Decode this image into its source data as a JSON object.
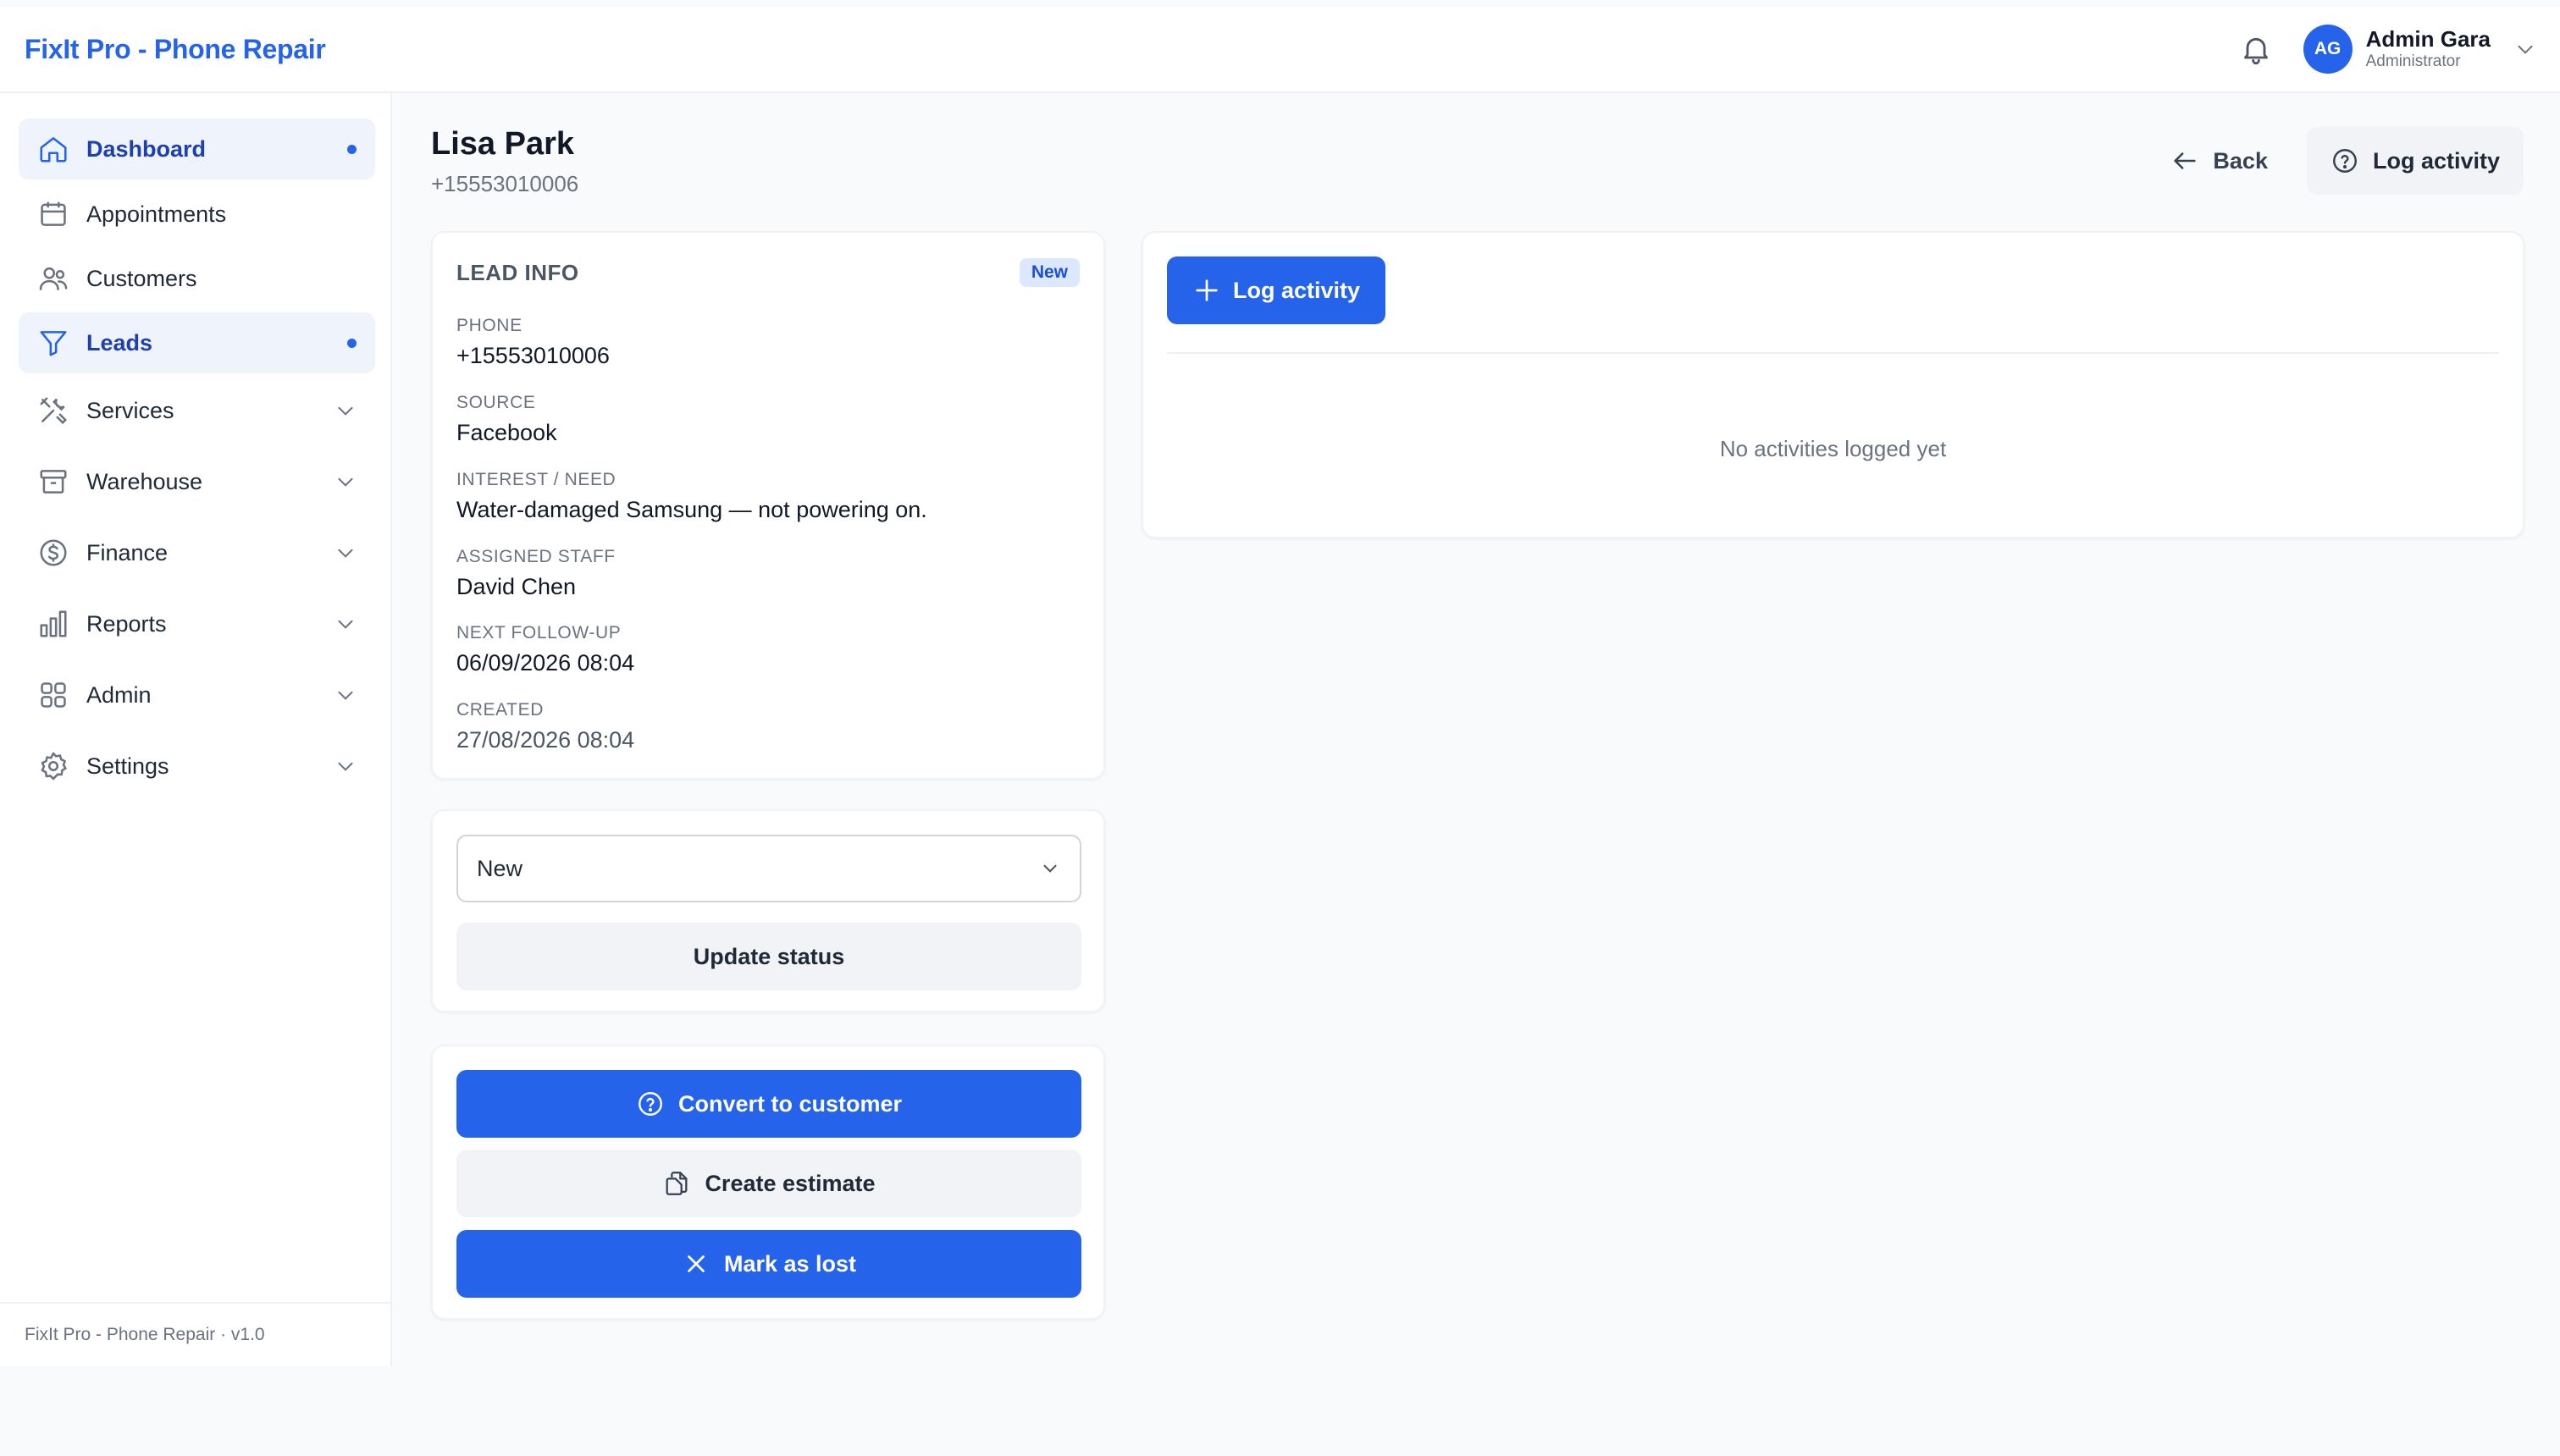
{
  "app": {
    "brand": "FixIt Pro - Phone Repair",
    "footer": "FixIt Pro - Phone Repair · v1.0"
  },
  "user": {
    "initials": "AG",
    "name": "Admin Gara",
    "role": "Administrator"
  },
  "sidebar": {
    "items": [
      {
        "label": "Dashboard",
        "icon": "home-icon",
        "active": true
      },
      {
        "label": "Appointments",
        "icon": "calendar-icon"
      },
      {
        "label": "Customers",
        "icon": "users-icon"
      },
      {
        "label": "Leads",
        "icon": "funnel-icon",
        "active": true
      },
      {
        "label": "Services",
        "icon": "tools-icon",
        "expandable": true
      },
      {
        "label": "Warehouse",
        "icon": "archive-icon",
        "expandable": true
      },
      {
        "label": "Finance",
        "icon": "dollar-icon",
        "expandable": true
      },
      {
        "label": "Reports",
        "icon": "bar-chart-icon",
        "expandable": true
      },
      {
        "label": "Admin",
        "icon": "grid-icon",
        "expandable": true
      },
      {
        "label": "Settings",
        "icon": "gear-icon",
        "expandable": true
      }
    ]
  },
  "lead": {
    "name": "Lisa Park",
    "phone_sub": "+15553010006"
  },
  "header_actions": {
    "back": "Back",
    "log_activity": "Log activity"
  },
  "lead_info": {
    "title": "LEAD INFO",
    "badge": "New",
    "fields": [
      {
        "label": "PHONE",
        "value": "+15553010006"
      },
      {
        "label": "SOURCE",
        "value": "Facebook"
      },
      {
        "label": "INTEREST / NEED",
        "value": "Water-damaged Samsung — not powering on."
      },
      {
        "label": "ASSIGNED STAFF",
        "value": "David Chen"
      },
      {
        "label": "NEXT FOLLOW-UP",
        "value": "06/09/2026 08:04"
      },
      {
        "label": "CREATED",
        "value": "27/08/2026 08:04"
      }
    ]
  },
  "status": {
    "selected": "New",
    "update_label": "Update status"
  },
  "actions": {
    "convert": "Convert to customer",
    "estimate": "Create estimate",
    "lost": "Mark as lost"
  },
  "activity": {
    "log_button": "Log activity",
    "empty": "No activities logged yet"
  },
  "colors": {
    "accent": "#2563eb",
    "active_bg": "#eef3fc",
    "badge_bg": "#dbe8fd"
  }
}
